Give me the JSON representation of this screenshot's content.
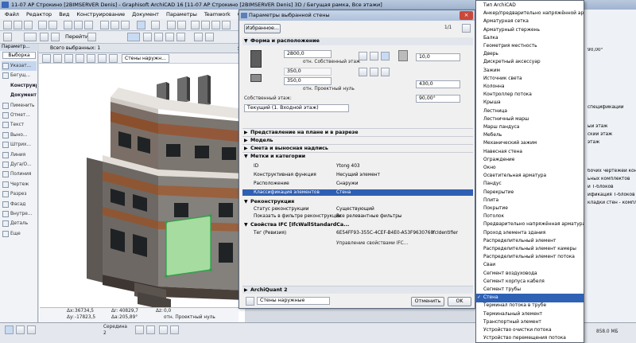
{
  "window": {
    "title": "11-07 АР Строкино [2BIMSERVER Denis] - Graphisoft ArchiCAD 16 [11-07 АР Строкино [2BIMSERVER Denis] 3D / Бегущая рамка, Все этажи]"
  },
  "menu": [
    "Файл",
    "Редактор",
    "Вид",
    "Конструирование",
    "Документ",
    "Параметры",
    "Teamwork",
    "Окно",
    "Справка"
  ],
  "toolbar": {
    "goto_label": "Перейти"
  },
  "toolbox": {
    "header": "Параметр...",
    "select_tab": "Выборка",
    "items": [
      {
        "label": "Указат...",
        "kind": "tool"
      },
      {
        "label": "Бегущ...",
        "kind": "tool"
      },
      {
        "label": "Конструир",
        "kind": "group"
      },
      {
        "label": "Документ",
        "kind": "group"
      },
      {
        "label": "Пименить",
        "kind": "tool"
      },
      {
        "label": "Отмет...",
        "kind": "tool"
      },
      {
        "label": "Текст",
        "kind": "tool"
      },
      {
        "label": "Выно...",
        "kind": "tool"
      },
      {
        "label": "Штрих...",
        "kind": "tool"
      },
      {
        "label": "Линия",
        "kind": "tool"
      },
      {
        "label": "Дуга/О...",
        "kind": "tool"
      },
      {
        "label": "Полиния",
        "kind": "tool"
      },
      {
        "label": "Чертеж",
        "kind": "tool"
      },
      {
        "label": "Разрез",
        "kind": "tool"
      },
      {
        "label": "Фасад",
        "kind": "tool"
      },
      {
        "label": "Внутре...",
        "kind": "tool"
      },
      {
        "label": "Деталь",
        "kind": "tool"
      },
      {
        "label": "Еще",
        "kind": "tool"
      }
    ]
  },
  "view": {
    "tab_label": "Всего выбранных: 1",
    "filter_label": "Стены наружн...",
    "coords": {
      "dx_label": "Δx:",
      "dx_value": "36734,5",
      "dy_label": "Δy:",
      "dy_value": "-17823,5",
      "a_label": "Δr:",
      "a_value": "40829,7",
      "angle_label": "Δa:",
      "angle_value": "205,89°",
      "z_label": "Δz:",
      "z_value": "0,0",
      "plane_label": "отн. Проектный нуль",
      "mid_label": "Середина",
      "mid_value": "2"
    }
  },
  "dialog": {
    "title": "Параметры выбранной стены",
    "favorites_button": "Избранное...",
    "top_right_value": "1/1",
    "section_geometry": "Форма и расположение",
    "height_value": "2800,0",
    "height_label": "отн. Собственный этаж",
    "base_value": "350,0",
    "base_label": "отн. Проектный нуль",
    "offset_value": "350,0",
    "home_story_label": "Собственный этаж:",
    "home_story_value": "Текущий (1. Входной этаж)",
    "thickness_value": "10,0",
    "width_value": "430,0",
    "angle_value": "90,00°",
    "sections": [
      {
        "label": "Представление на плане и в разрезе",
        "open": false
      },
      {
        "label": "Модель",
        "open": false
      },
      {
        "label": "Смета и выносная надпись",
        "open": false
      },
      {
        "label": "Метки и категории",
        "open": true
      }
    ],
    "props": [
      {
        "key": "ID",
        "value": "Ytong 403",
        "hl": false
      },
      {
        "key": "Конструктивная функция",
        "value": "Несущий элемент",
        "hl": false
      },
      {
        "key": "Расположение",
        "value": "Снаружи",
        "hl": false
      },
      {
        "key": "Классификация элементов",
        "value": "Стена",
        "hl": true
      }
    ],
    "renovation_header": "Реконструкция",
    "renovation": [
      {
        "key": "Статус реконструкции",
        "value": "Существующий"
      },
      {
        "key": "Показать в фильтре реконструкции",
        "value": "Все релевантные фильтры"
      }
    ],
    "ifc_header": "Свойства IFC [IfcWallStandardCa...",
    "ifc_tag_key": "Тег (Ревизия)",
    "ifc_tag_value": "6E54FF93-355C-4CEF-B4E0-A53F9630760",
    "ifc_id_label": "IfcIdentifier",
    "ifc_manage": "Управление свойствами IFC...",
    "archiquant_label": "ArchiQuant 2",
    "layer_label": "Стены наружные",
    "cancel_button": "Отменить",
    "ok_button": "OK"
  },
  "classification_dropdown": {
    "items": [
      "Тип ArchiCAD",
      "Анкер/предварительно напряжённой арматуры",
      "Арматурная сетка",
      "Арматурный стержень",
      "Балка",
      "Геометрия местность",
      "Дверь",
      "Дискретный аксессуар",
      "Зажим",
      "Источник света",
      "Колонна",
      "Контроллер потока",
      "Крыша",
      "Лестница",
      "Лестничный марш",
      "Марш пандуса",
      "Мебель",
      "Механический зажим",
      "Навесная стена",
      "Ограждение",
      "Окно",
      "Осветительная арматура",
      "Пандус",
      "Перекрытие",
      "Плита",
      "Покрытие",
      "Потолок",
      "Предварительно напряжённая арматура",
      "Проход элемента здания",
      "Распределительный элемент",
      "Распределительный элемент камеры",
      "Распределительный элемент потока",
      "Сваи",
      "Сегмент воздуховода",
      "Сегмент корпуса кабеля",
      "Сегмент трубы",
      "Стена",
      "Терминал потока в трубе",
      "Терминальный элемент",
      "Транспортный элемент",
      "Устройство очистки потока",
      "Устройство перемещения потока"
    ],
    "selected": "Стена"
  },
  "right_panel": {
    "values": [
      "90,00°",
      "спецификации",
      "ый этаж",
      "ский этаж",
      "этаж",
      "бочих чертежей конк",
      "ьных комплектов",
      "и Т-блоков",
      "ификация Т-блоков",
      "кладки стен - компле"
    ]
  },
  "status": {
    "memory": "858.0 МБ"
  }
}
